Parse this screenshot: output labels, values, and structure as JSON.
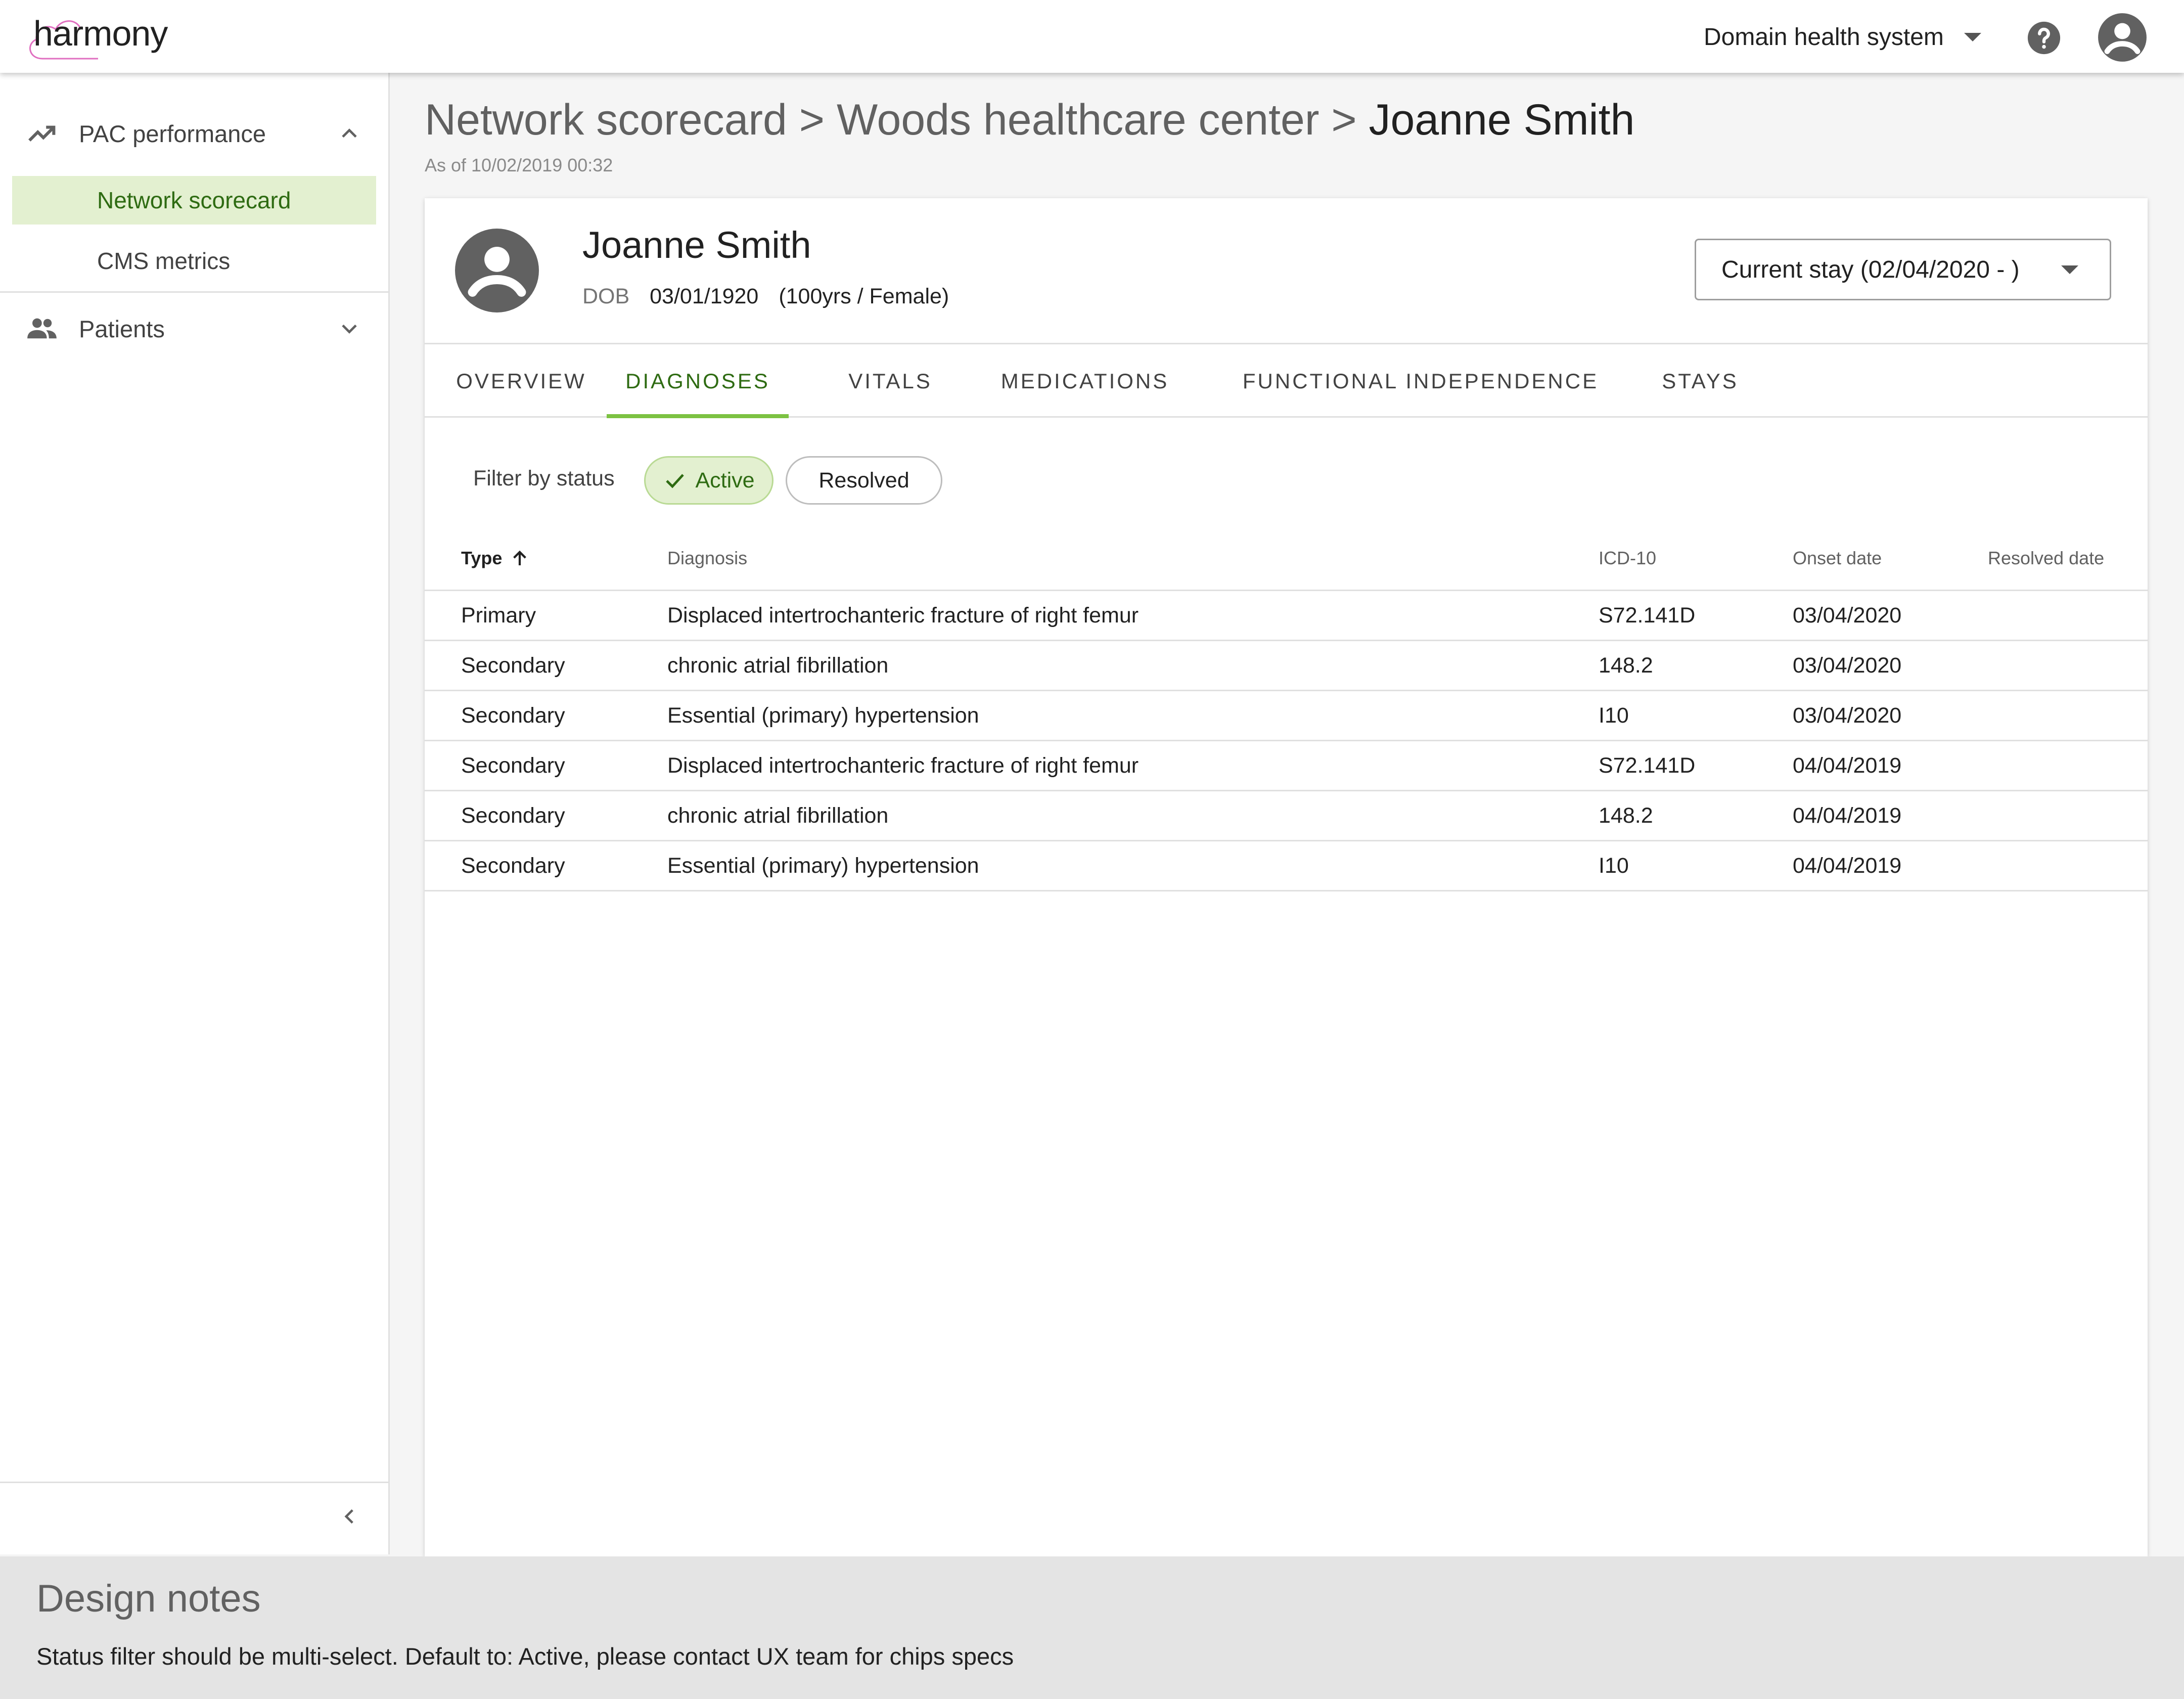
{
  "header": {
    "logo_text": "harmony",
    "org_selector": "Domain health system",
    "icons": [
      "cloud-logo",
      "chevron-down-icon",
      "help-icon",
      "account-circle-icon"
    ]
  },
  "sidebar": {
    "groups": [
      {
        "label": "PAC performance",
        "icon": "trending-up-icon",
        "expanded": true
      },
      {
        "label": "Patients",
        "icon": "people-icon",
        "expanded": false
      }
    ],
    "items": [
      {
        "label": "Network scorecard",
        "active": true
      },
      {
        "label": "CMS metrics",
        "active": false
      }
    ],
    "collapse_icon": "chevron-left-icon"
  },
  "breadcrumb": {
    "crumb1": "Network scorecard",
    "sep1": ">",
    "crumb2": "Woods healthcare center",
    "sep2": ">",
    "current": "Joanne Smith"
  },
  "as_of": "As of 10/02/2019 00:32",
  "patient": {
    "name": "Joanne Smith",
    "dob_label": "DOB",
    "dob": "03/01/1920",
    "age_sex": "(100yrs / Female)",
    "stay_select": "Current stay (02/04/2020 - )"
  },
  "tabs": [
    {
      "label": "OVERVIEW",
      "active": false
    },
    {
      "label": "DIAGNOSES",
      "active": true
    },
    {
      "label": "VITALS",
      "active": false
    },
    {
      "label": "MEDICATIONS",
      "active": false
    },
    {
      "label": "FUNCTIONAL INDEPENDENCE",
      "active": false
    },
    {
      "label": "STAYS",
      "active": false
    }
  ],
  "filter": {
    "label": "Filter by status",
    "chips": [
      {
        "label": "Active",
        "selected": true
      },
      {
        "label": "Resolved",
        "selected": false
      }
    ]
  },
  "table": {
    "columns": [
      "Type",
      "Diagnosis",
      "ICD-10",
      "Onset date",
      "Resolved date"
    ],
    "sort_column": "Type",
    "sort_direction": "ascending",
    "rows": [
      [
        "Primary",
        "Displaced intertrochanteric fracture of right femur",
        "S72.141D",
        "03/04/2020",
        ""
      ],
      [
        "Secondary",
        "chronic atrial fibrillation",
        "148.2",
        "03/04/2020",
        ""
      ],
      [
        "Secondary",
        "Essential (primary) hypertension",
        "I10",
        "03/04/2020",
        ""
      ],
      [
        "Secondary",
        "Displaced intertrochanteric fracture of right femur",
        "S72.141D",
        "04/04/2019",
        ""
      ],
      [
        "Secondary",
        "chronic atrial fibrillation",
        "148.2",
        "04/04/2019",
        ""
      ],
      [
        "Secondary",
        "Essential (primary) hypertension",
        "I10",
        "04/04/2019",
        ""
      ]
    ]
  },
  "design_notes": {
    "title": "Design notes",
    "text": "Status filter should be multi-select. Default to: Active, please contact UX team for chips specs"
  },
  "colors": {
    "accent_green": "#7cc242",
    "active_text_green": "#2e6b12",
    "active_bg": "#e3f0d0",
    "logo_pink": "#e06fc0"
  }
}
